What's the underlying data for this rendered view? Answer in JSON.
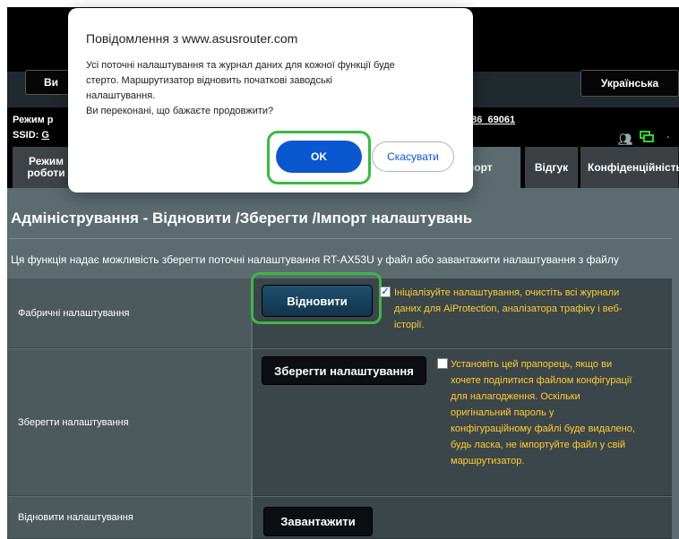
{
  "router": {
    "view_button_label": "Ви",
    "language_label": "Українська",
    "mode_line_prefix": "Режим р",
    "ssid_label": "SSID:",
    "ssid_value": "G",
    "ssid_tail": "386_69061",
    "tabs": [
      {
        "label": "Режим роботи"
      },
      {
        "label": "порт"
      },
      {
        "label": "Відгук"
      },
      {
        "label": "Конфіденційність"
      }
    ],
    "page_title": "Адміністрування - Відновити /Зберегти /Імпорт налаштувань",
    "description": "Ця функція надає можливість зберегти поточні налаштування RT-AX53U у файл або завантажити налаштування з файлу",
    "rows": [
      {
        "label": "Фабричні налаштування",
        "button": "Відновити",
        "checkbox_checked": true,
        "note_lines": [
          "Ініціалізуйте налаштування, очистіть всі журнали",
          "даних для AiProtection, аналізатора трафіку і веб-",
          "історії."
        ]
      },
      {
        "label": "Зберегти налаштування",
        "button": "Зберегти налаштування",
        "checkbox_checked": false,
        "note_lines": [
          "Установіть цей прапорець, якщо ви",
          "хочете поділитися файлом конфігурації",
          "для налагодження. Оскільки",
          "оригінальний пароль у",
          "конфігураційному файлі буде видалено,",
          "будь ласка, не імпортуйте файл у свій",
          "маршрутизатор."
        ]
      },
      {
        "label": "Відновити налаштування",
        "button": "Завантажити"
      }
    ]
  },
  "modal": {
    "title": "Повідомлення з www.asusrouter.com",
    "message_lines": [
      "Усі поточні налаштування та журнал даних для кожної функції буде",
      "стерто. Маршрутизатор відновить початкові заводські",
      "налаштування.",
      "Ви переконані, що бажаєте продовжити?"
    ],
    "ok_label": "OK",
    "cancel_label": "Скасувати"
  },
  "colors": {
    "highlight": "#3db844",
    "ok_button": "#0b57d0",
    "note_text": "#ffcc33",
    "panel_bg": "#5b6b70"
  },
  "icons": [
    "users-icon",
    "network-icon"
  ]
}
